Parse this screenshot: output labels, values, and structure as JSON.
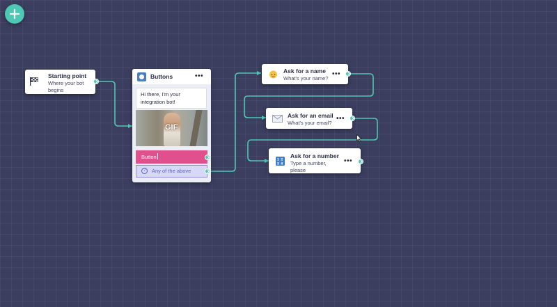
{
  "toolbar": {
    "add_label": "+"
  },
  "nodes": {
    "start": {
      "title": "Starting point",
      "subtitle": "Where your bot begins",
      "icon": "checkered-flag-icon"
    },
    "buttons": {
      "title": "Buttons",
      "menu": "•••",
      "message": "Hi there, I'm your integration bot!",
      "gif_label": "GIF",
      "button_label": "Button",
      "fallback_label": "Any of the above",
      "fallback_icon": "?"
    },
    "name": {
      "title": "Ask for a name",
      "subtitle": "What's your name?",
      "menu": "•••",
      "icon": "face-icon"
    },
    "email": {
      "title": "Ask for an email",
      "subtitle": "What's your email?",
      "menu": "•••",
      "icon": "envelope-icon"
    },
    "number": {
      "title": "Ask for a number",
      "subtitle": "Type a number, please",
      "menu": "•••",
      "icon": "number-keypad-icon"
    }
  },
  "colors": {
    "canvas": "#3b3e5f",
    "accent": "#4ec7b4",
    "button_pink": "#e0508d",
    "fallback": "#d7d8f7"
  }
}
